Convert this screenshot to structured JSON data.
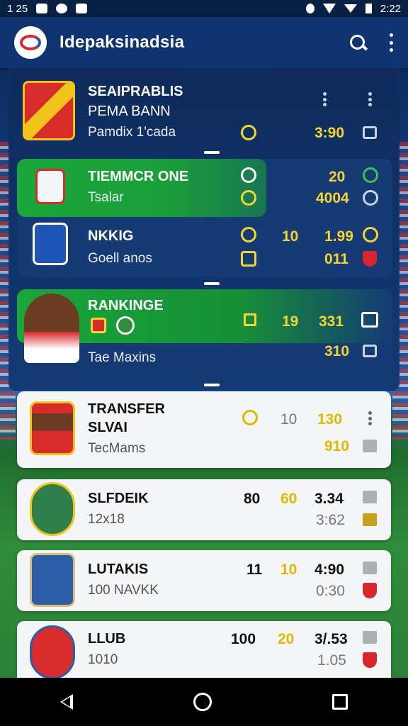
{
  "statusbar": {
    "left_text": "1 25",
    "time": "2:22"
  },
  "app": {
    "title": "Idepaksinadsia"
  },
  "panel": {
    "row1": {
      "title_line1": "SEAIPRABLIS",
      "title_line2": "PEMA BANN",
      "subtitle": "Pamdix 1'cada",
      "value": "3:90"
    },
    "row2": {
      "title": "TIEMMCR ONE",
      "subtitle": "Tsalar",
      "value_top": "20",
      "value_bottom": "4004"
    },
    "row3": {
      "title": "NKKIG",
      "subtitle": "Goell anos",
      "value_a": "10",
      "value_b": "1.99",
      "value_c": "011"
    },
    "row4": {
      "title": "RANKINGE",
      "subtitle": "Tae Maxins",
      "value_a": "19",
      "value_b": "331",
      "value_c": "310"
    }
  },
  "list": [
    {
      "title_line1": "TRANSFER",
      "title_line2": "SLVAI",
      "subtitle": "TecMams",
      "v1": "",
      "v2": "10",
      "v3": "130",
      "v4": "910"
    },
    {
      "title_line1": "SLFDEIK",
      "title_line2": "",
      "subtitle": "12x18",
      "v1": "80",
      "v2": "60",
      "v3": "3.34",
      "v4": "3:62"
    },
    {
      "title_line1": "LUTAKIS",
      "title_line2": "",
      "subtitle": "100 NAVKK",
      "v1": "11",
      "v2": "10",
      "v3": "4:90",
      "v4": "0:30"
    },
    {
      "title_line1": "LLUB",
      "title_line2": "",
      "subtitle": "1010",
      "v1": "100",
      "v2": "20",
      "v3": "3/.53",
      "v4": "1.05"
    }
  ],
  "colors": {
    "accent_yellow": "#f4d630",
    "green": "#1aa33a",
    "navy": "#0f3470"
  }
}
